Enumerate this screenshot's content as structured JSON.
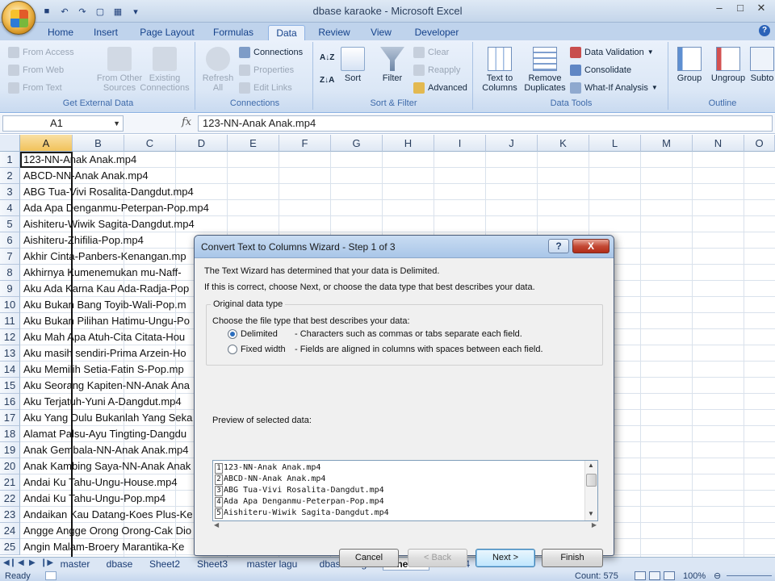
{
  "window": {
    "title": "dbase karaoke - Microsoft Excel",
    "minimize": "–",
    "maximize": "□",
    "close": "✕"
  },
  "ribbon": {
    "tabs": [
      "Home",
      "Insert",
      "Page Layout",
      "Formulas",
      "Data",
      "Review",
      "View",
      "Developer"
    ],
    "active_tab": "Data",
    "groups": {
      "get_external": {
        "label": "Get External Data",
        "from_access": "From Access",
        "from_web": "From Web",
        "from_text": "From Text",
        "from_other_1": "From Other",
        "from_other_2": "Sources",
        "existing_1": "Existing",
        "existing_2": "Connections"
      },
      "connections": {
        "label": "Connections",
        "refresh_1": "Refresh",
        "refresh_2": "All",
        "connections": "Connections",
        "properties": "Properties",
        "edit_links": "Edit Links"
      },
      "sort_filter": {
        "label": "Sort & Filter",
        "sort": "Sort",
        "filter": "Filter",
        "clear": "Clear",
        "reapply": "Reapply",
        "advanced": "Advanced"
      },
      "data_tools": {
        "label": "Data Tools",
        "text_to_1": "Text to",
        "text_to_2": "Columns",
        "remove_1": "Remove",
        "remove_2": "Duplicates",
        "validation": "Data Validation",
        "consolidate": "Consolidate",
        "what_if": "What-If Analysis"
      },
      "outline": {
        "label": "Outline",
        "group": "Group",
        "ungroup": "Ungroup",
        "subtotal": "Subto"
      }
    }
  },
  "formula_bar": {
    "name_box": "A1",
    "fx": "fx",
    "value": "123-NN-Anak Anak.mp4"
  },
  "grid": {
    "columns": [
      "A",
      "B",
      "C",
      "D",
      "E",
      "F",
      "G",
      "H",
      "I",
      "J",
      "K",
      "L",
      "M",
      "N",
      "O"
    ],
    "rows": [
      {
        "n": "1",
        "a": "123-NN-Anak Anak.mp4"
      },
      {
        "n": "2",
        "a": "ABCD-NN-Anak Anak.mp4"
      },
      {
        "n": "3",
        "a": "ABG Tua-Vivi Rosalita-Dangdut.mp4"
      },
      {
        "n": "4",
        "a": "Ada Apa Denganmu-Peterpan-Pop.mp4"
      },
      {
        "n": "5",
        "a": "Aishiteru-Wiwik Sagita-Dangdut.mp4"
      },
      {
        "n": "6",
        "a": "Aishiteru-Zhifilia-Pop.mp4"
      },
      {
        "n": "7",
        "a": "Akhir Cinta-Panbers-Kenangan.mp"
      },
      {
        "n": "8",
        "a": "Akhirnya Kumenemukan mu-Naff-"
      },
      {
        "n": "9",
        "a": "Aku Ada Karna Kau Ada-Radja-Pop"
      },
      {
        "n": "10",
        "a": "Aku Bukan Bang Toyib-Wali-Pop.m"
      },
      {
        "n": "11",
        "a": "Aku Bukan Pilihan Hatimu-Ungu-Po"
      },
      {
        "n": "12",
        "a": "Aku Mah Apa Atuh-Cita Citata-Hou"
      },
      {
        "n": "13",
        "a": "Aku masih sendiri-Prima Arzein-Ho"
      },
      {
        "n": "14",
        "a": "Aku Memilih Setia-Fatin S-Pop.mp"
      },
      {
        "n": "15",
        "a": "Aku Seorang Kapiten-NN-Anak Ana"
      },
      {
        "n": "16",
        "a": "Aku Terjatuh-Yuni A-Dangdut.mp4"
      },
      {
        "n": "17",
        "a": "Aku Yang Dulu Bukanlah Yang Seka"
      },
      {
        "n": "18",
        "a": "Alamat Palsu-Ayu Tingting-Dangdu"
      },
      {
        "n": "19",
        "a": "Anak Gembala-NN-Anak Anak.mp4"
      },
      {
        "n": "20",
        "a": "Anak Kambing Saya-NN-Anak Anak"
      },
      {
        "n": "21",
        "a": "Andai Ku Tahu-Ungu-House.mp4"
      },
      {
        "n": "22",
        "a": "Andai Ku Tahu-Ungu-Pop.mp4"
      },
      {
        "n": "23",
        "a": "Andaikan Kau Datang-Koes Plus-Ke"
      },
      {
        "n": "24",
        "a": "Angge Angge Orong Orong-Cak Dio"
      },
      {
        "n": "25",
        "a": "Angin Malam-Broery Marantika-Ke"
      }
    ]
  },
  "sheets": {
    "tabs": [
      "master",
      "dbase",
      "Sheet2",
      "Sheet3",
      "master lagu",
      "dbase langit",
      "Sheet1",
      "Sheet4"
    ],
    "active": "Sheet1"
  },
  "status": {
    "ready": "Ready",
    "count": "Count: 575",
    "zoom": "100%"
  },
  "dialog": {
    "title": "Convert Text to Columns Wizard - Step 1 of 3",
    "help": "?",
    "close": "X",
    "line1": "The Text Wizard has determined that your data is Delimited.",
    "line2": "If this is correct, choose Next, or choose the data type that best describes your data.",
    "group_label": "Original data type",
    "choose_label": "Choose the file type that best describes your data:",
    "options": [
      {
        "label": "Delimited",
        "desc": "- Characters such as commas or tabs separate each field.",
        "checked": true
      },
      {
        "label": "Fixed width",
        "desc": "- Fields are aligned in columns with spaces between each field.",
        "checked": false
      }
    ],
    "preview_label": "Preview of selected data:",
    "preview_lines": [
      {
        "n": "1",
        "text": "123-NN-Anak Anak.mp4"
      },
      {
        "n": "2",
        "text": "ABCD-NN-Anak Anak.mp4"
      },
      {
        "n": "3",
        "text": "ABG Tua-Vivi Rosalita-Dangdut.mp4"
      },
      {
        "n": "4",
        "text": "Ada Apa Denganmu-Peterpan-Pop.mp4"
      },
      {
        "n": "5",
        "text": "Aishiteru-Wiwik Sagita-Dangdut.mp4"
      }
    ],
    "buttons": {
      "cancel": "Cancel",
      "back": "< Back",
      "next": "Next >",
      "finish": "Finish"
    }
  }
}
